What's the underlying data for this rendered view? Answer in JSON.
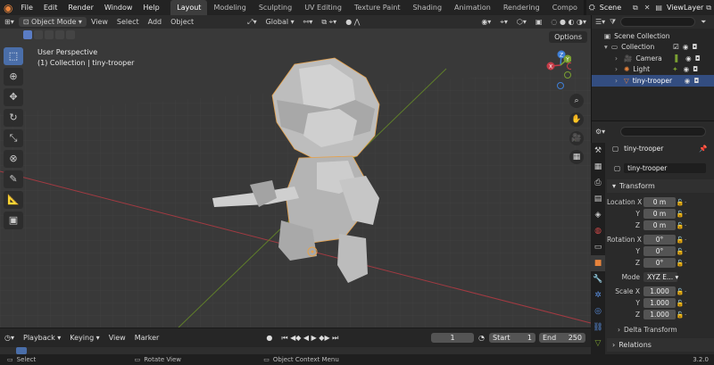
{
  "topbar": {
    "menus": [
      "File",
      "Edit",
      "Render",
      "Window",
      "Help"
    ],
    "workspaces": [
      "Layout",
      "Modeling",
      "Sculpting",
      "UV Editing",
      "Texture Paint",
      "Shading",
      "Animation",
      "Rendering",
      "Compo"
    ],
    "active_workspace": "Layout",
    "scene": "Scene",
    "view_layer": "ViewLayer"
  },
  "viewport": {
    "mode": "Object Mode",
    "menus": [
      "View",
      "Select",
      "Add",
      "Object"
    ],
    "transform_orientation": "Global",
    "perspective": "User Perspective",
    "collection_info": "(1) Collection | tiny-trooper",
    "options": "Options",
    "gizmo": {
      "x": "X",
      "y": "Y",
      "z": "Z"
    }
  },
  "timeline": {
    "menus": [
      "Playback",
      "Keying",
      "View",
      "Marker"
    ],
    "current_frame": "1",
    "start_label": "Start",
    "start": "1",
    "end_label": "End",
    "end": "250"
  },
  "status": {
    "select": "Select",
    "rotate": "Rotate View",
    "context": "Object Context Menu",
    "version": "3.2.0"
  },
  "outliner": {
    "items": [
      {
        "label": "Scene Collection",
        "icon": "scene-collection-icon"
      },
      {
        "label": "Collection",
        "icon": "collection-icon"
      },
      {
        "label": "Camera",
        "icon": "camera-icon"
      },
      {
        "label": "Light",
        "icon": "light-icon"
      },
      {
        "label": "tiny-trooper",
        "icon": "mesh-icon"
      }
    ]
  },
  "properties": {
    "object_name": "tiny-trooper",
    "datablock": "tiny-trooper",
    "transform": "Transform",
    "location_label": "Location X",
    "rotation_label": "Rotation X",
    "scale_label": "Scale X",
    "axis_y": "Y",
    "axis_z": "Z",
    "location": [
      "0 m",
      "0 m",
      "0 m"
    ],
    "rotation": [
      "0°",
      "0°",
      "0°"
    ],
    "mode_label": "Mode",
    "mode": "XYZ E...",
    "scale": [
      "1.000",
      "1.000",
      "1.000"
    ],
    "delta_transform": "Delta Transform",
    "relations": "Relations"
  },
  "colors": {
    "accent": "#4a6ea9",
    "x_axis": "#c53c48",
    "y_axis": "#7aa032",
    "z_axis": "#3f7fd6",
    "highlight": "#334d80"
  }
}
